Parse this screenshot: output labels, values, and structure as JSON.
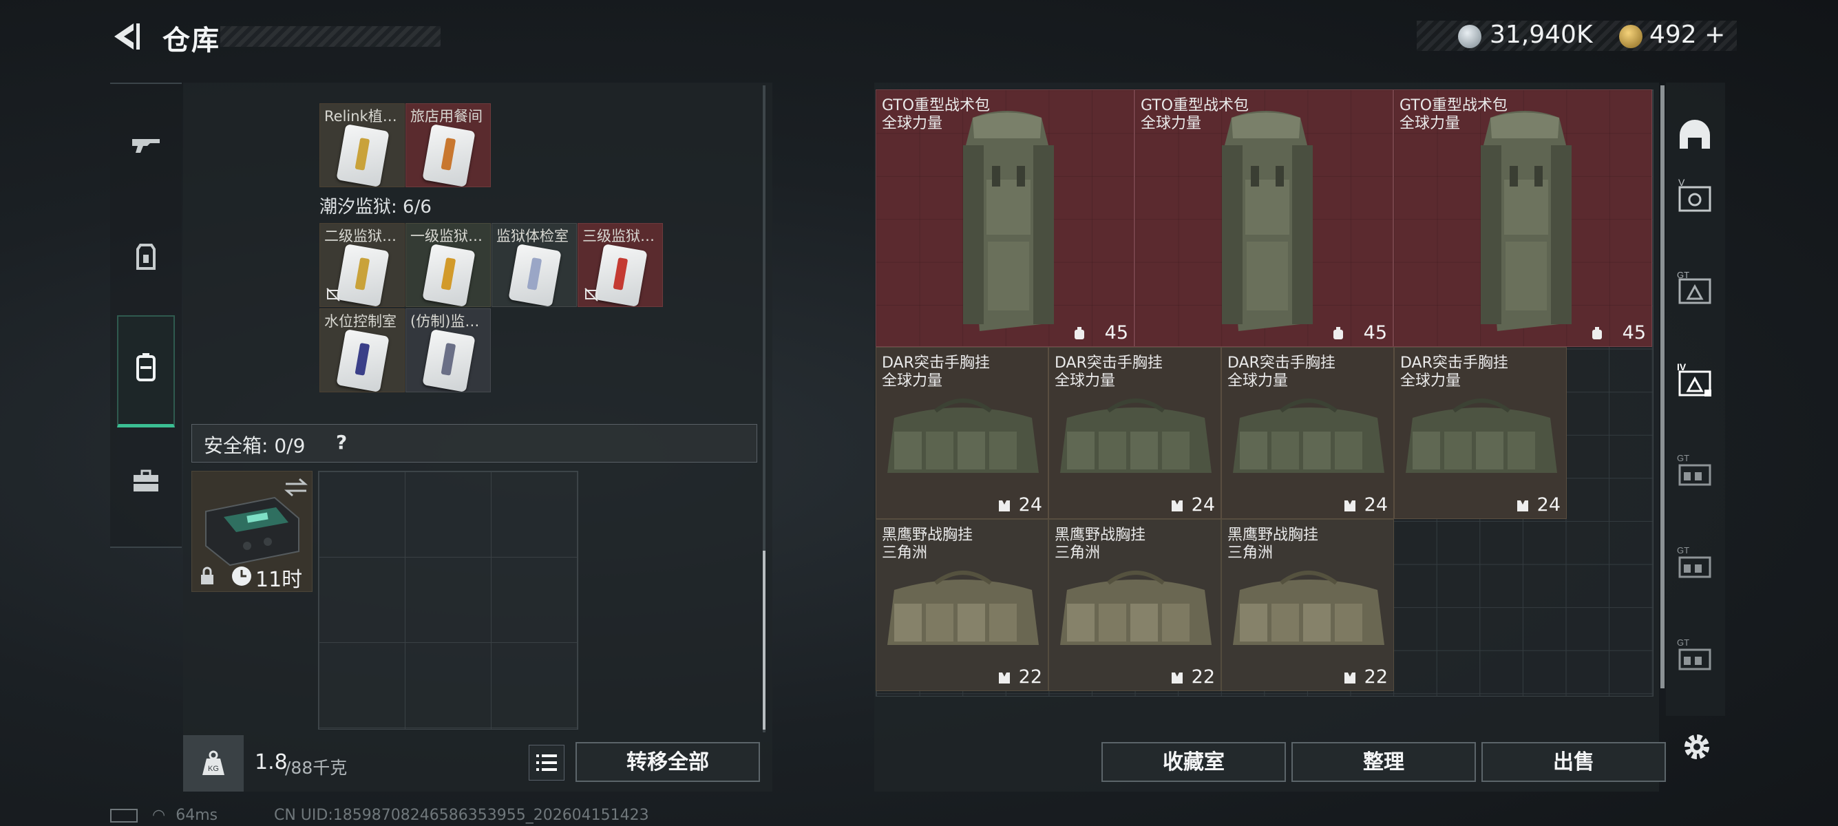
{
  "header": {
    "title": "仓库"
  },
  "currency": {
    "coins": "31,940K",
    "gold": "492",
    "gold_add": "+"
  },
  "left_nav": [
    {
      "icon": "rifle-icon"
    },
    {
      "icon": "armor-vest-icon"
    },
    {
      "icon": "backpack-icon",
      "selected": true
    },
    {
      "icon": "toolbox-icon"
    }
  ],
  "keycards_top": [
    {
      "label": "Relink植…",
      "stripe": "#c9a23a"
    },
    {
      "label": "旅店用餐间",
      "stripe": "#c8772f"
    }
  ],
  "tidal": {
    "label": "潮汐监狱: 6/6",
    "cards": [
      {
        "label": "二级监狱…",
        "stripe": "#c9a23a",
        "unavailable": true
      },
      {
        "label": "一级监狱…",
        "stripe": "#d29a2a"
      },
      {
        "label": "监狱体检室",
        "stripe": "#9aa6c6"
      },
      {
        "label": "三级监狱…",
        "stripe": "#c43a32",
        "unavailable": true
      },
      {
        "label": "水位控制室",
        "stripe": "#3a3f88"
      },
      {
        "label": "(仿制)监…",
        "stripe": "#6a6f86"
      }
    ]
  },
  "safe_box": {
    "label": "安全箱: 0/9",
    "help": "?",
    "timer": "11时"
  },
  "bottom_left": {
    "weight_current": "1.8",
    "weight_cap": "/88千克",
    "transfer_all": "转移全部"
  },
  "stash": {
    "backpacks": [
      {
        "name": "GTO重型战术包",
        "sub": "全球力量",
        "capacity": "45"
      },
      {
        "name": "GTO重型战术包",
        "sub": "全球力量",
        "capacity": "45"
      },
      {
        "name": "GTO重型战术包",
        "sub": "全球力量",
        "capacity": "45"
      }
    ],
    "rigs_dar": [
      {
        "name": "DAR突击手胸挂",
        "sub": "全球力量",
        "capacity": "24"
      },
      {
        "name": "DAR突击手胸挂",
        "sub": "全球力量",
        "capacity": "24"
      },
      {
        "name": "DAR突击手胸挂",
        "sub": "全球力量",
        "capacity": "24"
      },
      {
        "name": "DAR突击手胸挂",
        "sub": "全球力量",
        "capacity": "24"
      }
    ],
    "rigs_hawk": [
      {
        "name": "黑鹰野战胸挂",
        "sub": "三角洲",
        "capacity": "22"
      },
      {
        "name": "黑鹰野战胸挂",
        "sub": "三角洲",
        "capacity": "22"
      },
      {
        "name": "黑鹰野战胸挂",
        "sub": "三角洲",
        "capacity": "22"
      }
    ]
  },
  "bottom_right": {
    "collection": "收藏室",
    "sort": "整理",
    "sell": "出售"
  },
  "right_nav": [
    {
      "icon": "helmet-icon",
      "label": ""
    },
    {
      "icon": "armor-plate-icon",
      "label": "V"
    },
    {
      "icon": "armor-plate-icon",
      "label": "GT"
    },
    {
      "icon": "backpack-tier-icon",
      "label": "IV"
    },
    {
      "icon": "chest-rig-icon",
      "label": "GT"
    },
    {
      "icon": "chest-rig-icon",
      "label": "GT"
    },
    {
      "icon": "chest-rig-icon",
      "label": "GT"
    }
  ],
  "status": {
    "ping": "64ms",
    "uid": "CN UID:1859870824658635395​5_202604151423"
  }
}
